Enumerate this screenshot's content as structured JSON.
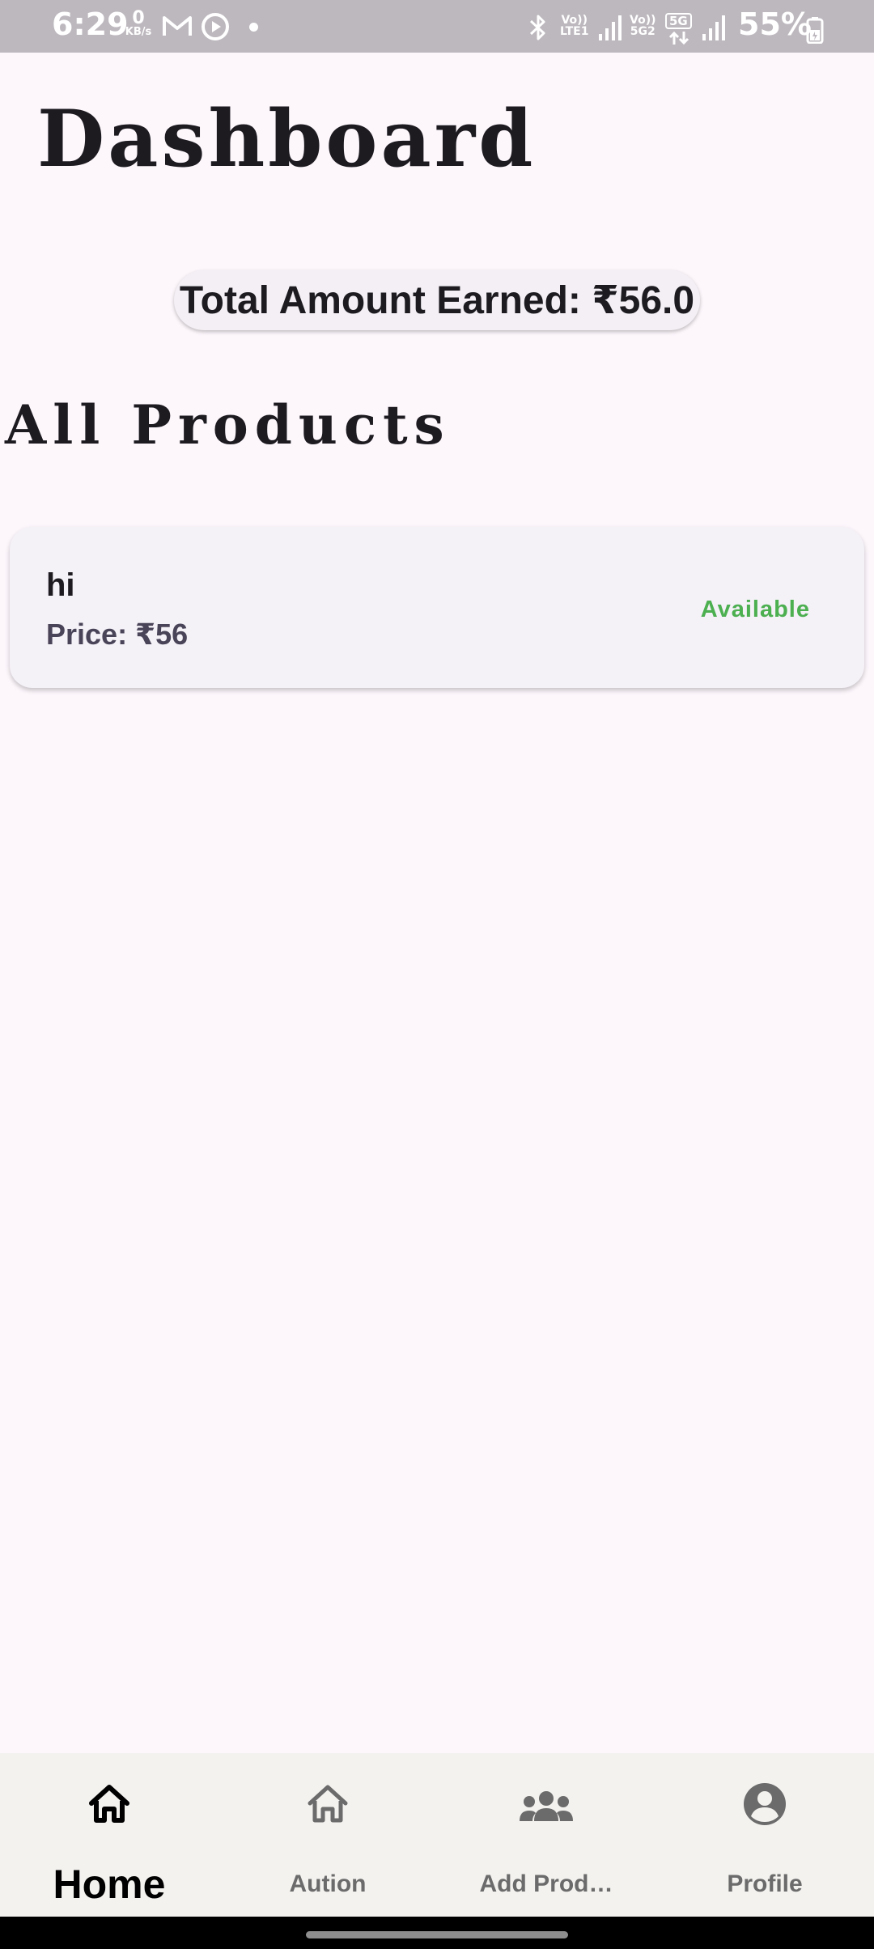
{
  "status_bar": {
    "time": "6:29",
    "net_speed_value": "0",
    "net_speed_unit": "KB/s",
    "sim1_label_top": "Vo))",
    "sim1_label_bottom": "LTE1",
    "sim2_label_top": "Vo))",
    "sim2_label_bottom": "5G2",
    "network_type": "5G",
    "battery": "55%",
    "icons": [
      "gmail-icon",
      "media-icon",
      "notification-dot",
      "bluetooth-icon",
      "signal-icon",
      "battery-icon"
    ]
  },
  "page": {
    "title": "Dashboard",
    "total_earned": "Total Amount Earned: ₹56.0",
    "section_title": "All Products"
  },
  "products": [
    {
      "name": "hi",
      "price": "Price: ₹56",
      "status": "Available",
      "status_color": "#4caf50"
    }
  ],
  "bottom_nav": {
    "items": [
      {
        "label": "Home",
        "icon": "home-icon",
        "active": true
      },
      {
        "label": "Aution",
        "icon": "home-outline-icon",
        "active": false
      },
      {
        "label": "Add Prod…",
        "icon": "groups-icon",
        "active": false
      },
      {
        "label": "Profile",
        "icon": "account-circle-icon",
        "active": false
      }
    ]
  },
  "colors": {
    "background": "#fdf7fc",
    "status_bar": "#bdb8be",
    "nav_bar": "#f3f2ef",
    "available": "#4caf50"
  }
}
